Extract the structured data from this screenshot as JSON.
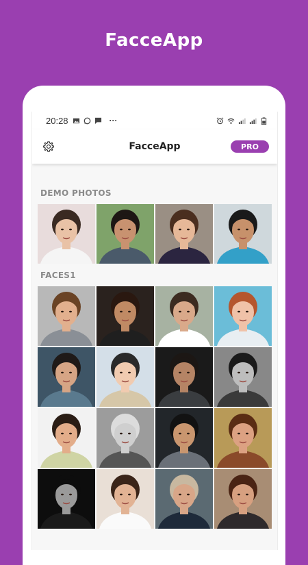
{
  "promo": {
    "title": "FacceApp"
  },
  "status_bar": {
    "time": "20:28",
    "more": "···"
  },
  "app_bar": {
    "title": "FacceApp",
    "pro_label": "PRO"
  },
  "sections": [
    {
      "label": "DEMO PHOTOS",
      "tile_count": 4
    },
    {
      "label": "FACES1",
      "tile_count": 16
    }
  ],
  "colors": {
    "brand_purple": "#9a3fb0",
    "background": "#f7f7f7",
    "section_label": "#8a8a8a"
  },
  "icons": {
    "settings": "gear-icon",
    "status_left": [
      "image-icon",
      "whatsapp-icon",
      "message-icon"
    ],
    "status_right": [
      "alarm-icon",
      "wifi-icon",
      "signal-icon",
      "signal-icon",
      "battery-icon"
    ]
  }
}
